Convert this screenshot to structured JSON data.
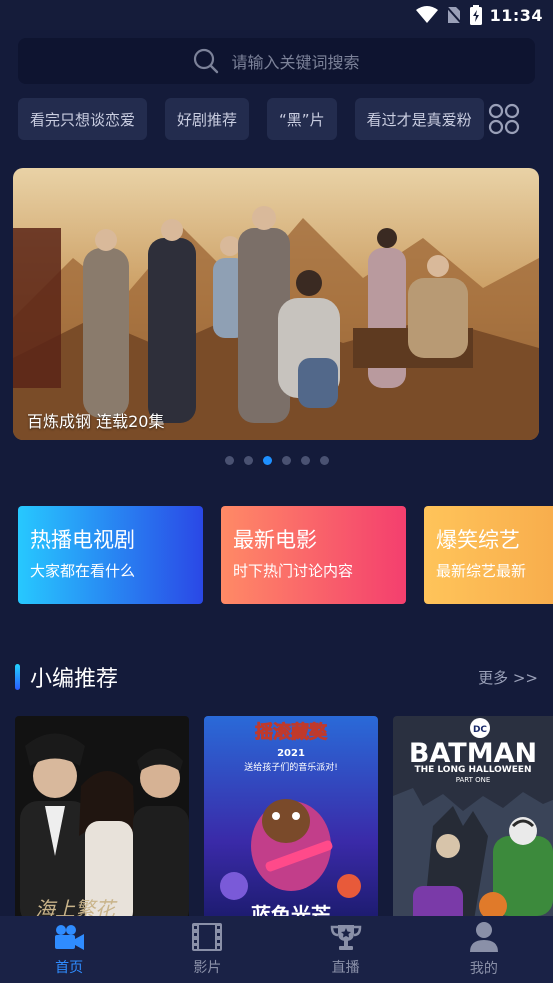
{
  "status": {
    "time": "11:34"
  },
  "search": {
    "placeholder": "请输入关键词搜索"
  },
  "tags": [
    {
      "label": "看完只想谈恋爱"
    },
    {
      "label": "好剧推荐"
    },
    {
      "label": "“黑”片"
    },
    {
      "label": "看过才是真爱粉"
    }
  ],
  "banner": {
    "caption": "百炼成钢 连载20集",
    "dot_count": 6,
    "active_dot": 3
  },
  "cards": [
    {
      "title": "热播电视剧",
      "subtitle": "大家都在看什么"
    },
    {
      "title": "最新电影",
      "subtitle": "时下热门讨论内容"
    },
    {
      "title": "爆笑综艺",
      "subtitle": "最新综艺最新"
    }
  ],
  "section": {
    "title": "小编推荐",
    "more": "更多 >>"
  },
  "posters": [
    {
      "title_art": "海上繁花"
    },
    {
      "title_art": "摇滚藏獒",
      "year_line": "2021",
      "tagline": "送给孩子们的音乐派对!",
      "bottom_art": "蓝色光芒"
    },
    {
      "title_art": "BATMAN",
      "subtitle_art": "THE LONG HALLOWEEN",
      "part_art": "PART ONE",
      "logo_art": "DC"
    }
  ],
  "nav": [
    {
      "label": "首页",
      "icon": "video-camera-icon",
      "active": true
    },
    {
      "label": "影片",
      "icon": "film-icon",
      "active": false
    },
    {
      "label": "直播",
      "icon": "trophy-icon",
      "active": false
    },
    {
      "label": "我的",
      "icon": "user-icon",
      "active": false
    }
  ],
  "colors": {
    "background": "#141b3a",
    "accent": "#1e90ff",
    "nav_active": "#2f8cff"
  }
}
